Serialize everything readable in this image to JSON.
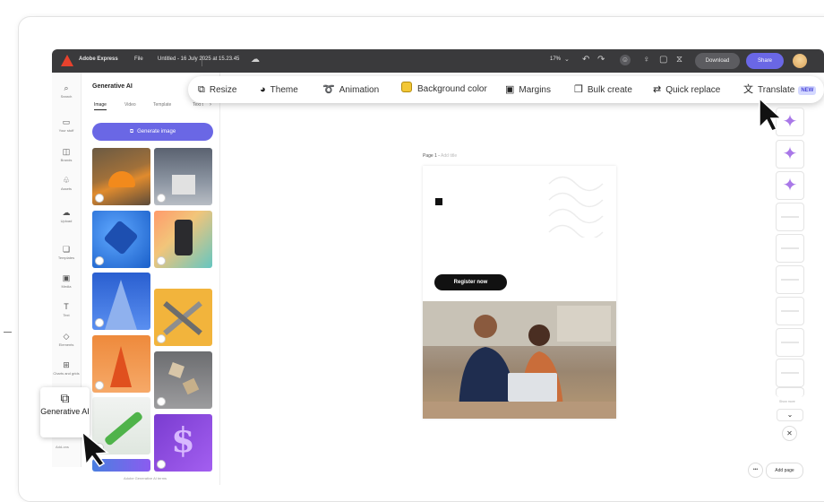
{
  "topbar": {
    "app_name": "Adobe Express",
    "file_menu": "File",
    "doc_title": "Untitled - 16 July 2025 at 15.23.45",
    "zoom": "17%",
    "download_label": "Download",
    "share_label": "Share"
  },
  "rail": {
    "items": [
      {
        "icon": "search-icon",
        "glyph": "⌕",
        "label": "Search"
      },
      {
        "icon": "your-stuff-icon",
        "glyph": "▭",
        "label": "Your stuff"
      },
      {
        "icon": "brands-icon",
        "glyph": "◫",
        "label": "Brands"
      },
      {
        "icon": "assets-icon",
        "glyph": "♧",
        "label": "Assets"
      },
      {
        "icon": "upload-icon",
        "glyph": "☁",
        "label": "Upload"
      },
      {
        "icon": "templates-icon",
        "glyph": "❏",
        "label": "Templates"
      },
      {
        "icon": "media-icon",
        "glyph": "▣",
        "label": "Media"
      },
      {
        "icon": "text-icon",
        "glyph": "T",
        "label": "Text"
      },
      {
        "icon": "elements-icon",
        "glyph": "◇",
        "label": "Elements"
      },
      {
        "icon": "charts-icon",
        "glyph": "⊞",
        "label": "Charts and grids"
      }
    ],
    "addons_label": "Add-ons"
  },
  "panel": {
    "title": "Generative AI",
    "tabs": [
      "Image",
      "Video",
      "Template",
      "Text t"
    ],
    "generate_label": "Generate image",
    "footer": "Adobe Generative AI terms"
  },
  "toolbar": {
    "items": [
      {
        "icon": "resize-icon",
        "glyph": "⧉",
        "label": "Resize"
      },
      {
        "icon": "theme-icon",
        "glyph": "◕",
        "label": "Theme"
      },
      {
        "icon": "animation-icon",
        "glyph": "➰",
        "label": "Animation"
      },
      {
        "icon": "background-color-icon",
        "glyph": "",
        "label": "Background color"
      },
      {
        "icon": "margins-icon",
        "glyph": "▣",
        "label": "Margins"
      },
      {
        "icon": "bulk-create-icon",
        "glyph": "❐",
        "label": "Bulk create"
      },
      {
        "icon": "quick-replace-icon",
        "glyph": "⇄",
        "label": "Quick replace"
      },
      {
        "icon": "translate-icon",
        "glyph": "文",
        "label": "Translate"
      }
    ],
    "new_badge": "NEW"
  },
  "canvas": {
    "page_label": "Page 1",
    "page_title_placeholder": "Add title",
    "register_label": "Register now"
  },
  "side": {
    "footer": "Show more"
  },
  "popup": {
    "label": "Generative AI"
  },
  "bottom": {
    "more": "•••",
    "add_page": "Add page"
  },
  "colors": {
    "accent": "#6a67e5",
    "topbar": "#3a3a3c",
    "star": "#a978e8"
  }
}
